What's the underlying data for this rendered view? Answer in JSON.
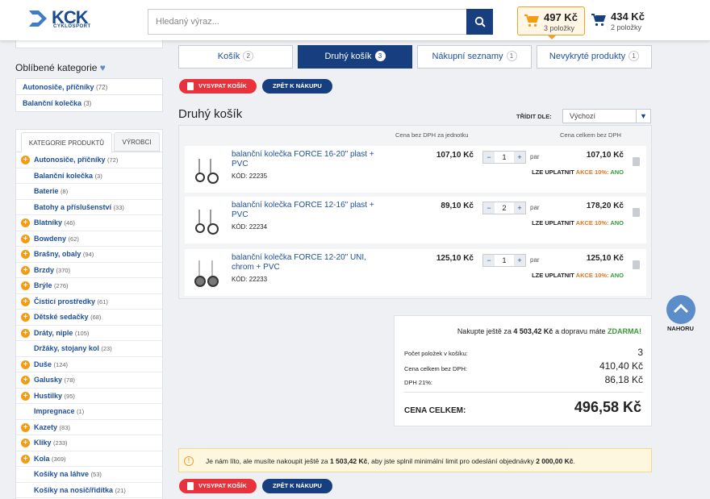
{
  "header": {
    "logo_text": "KCK",
    "logo_sub": "CYKLOSPORT",
    "search_placeholder": "Hledaný výraz...",
    "cart1": {
      "price": "497 Kč",
      "items": "3 položky"
    },
    "cart2": {
      "price": "434 Kč",
      "items": "2 položky"
    }
  },
  "sidebar": {
    "fav_title": "Oblíbené kategorie",
    "fav_items": [
      {
        "label": "Autonosiče, příčníky",
        "count": "(72)"
      },
      {
        "label": "Balanční kolečka",
        "count": "(3)"
      }
    ],
    "tab_categories": "KATEGORIE PRODUKTŮ",
    "tab_makers": "VÝROBCI",
    "categories": [
      {
        "label": "Autonosiče, příčníky",
        "count": "(72)",
        "plus": true
      },
      {
        "label": "Balanční kolečka",
        "count": "(3)",
        "plus": false
      },
      {
        "label": "Baterie",
        "count": "(8)",
        "plus": false
      },
      {
        "label": "Batohy a příslušenství",
        "count": "(33)",
        "plus": false
      },
      {
        "label": "Blatníky",
        "count": "(46)",
        "plus": true
      },
      {
        "label": "Bowdeny",
        "count": "(62)",
        "plus": true
      },
      {
        "label": "Brašny, obaly",
        "count": "(94)",
        "plus": true
      },
      {
        "label": "Brzdy",
        "count": "(370)",
        "plus": true
      },
      {
        "label": "Brýle",
        "count": "(276)",
        "plus": true
      },
      {
        "label": "Čisticí prostředky",
        "count": "(61)",
        "plus": true
      },
      {
        "label": "Dětské sedačky",
        "count": "(68)",
        "plus": true
      },
      {
        "label": "Dráty, niple",
        "count": "(105)",
        "plus": true
      },
      {
        "label": "Držáky, stojany kol",
        "count": "(23)",
        "plus": false
      },
      {
        "label": "Duše",
        "count": "(124)",
        "plus": true
      },
      {
        "label": "Galusky",
        "count": "(78)",
        "plus": true
      },
      {
        "label": "Hustilky",
        "count": "(95)",
        "plus": true
      },
      {
        "label": "Impregnace",
        "count": "(1)",
        "plus": false
      },
      {
        "label": "Kazety",
        "count": "(83)",
        "plus": true
      },
      {
        "label": "Kliky",
        "count": "(233)",
        "plus": true
      },
      {
        "label": "Kola",
        "count": "(369)",
        "plus": true
      },
      {
        "label": "Košíky na láhve",
        "count": "(53)",
        "plus": false
      },
      {
        "label": "Košíky na nosič/řidítka",
        "count": "(21)",
        "plus": false
      }
    ]
  },
  "tabs": [
    {
      "label": "Košík",
      "badge": "2"
    },
    {
      "label": "Druhý košík",
      "badge": "3"
    },
    {
      "label": "Nákupní seznamy",
      "badge": "1"
    },
    {
      "label": "Nevykryté produkty",
      "badge": "1"
    }
  ],
  "actions": {
    "empty_cart": "VYSYPAT KOŠÍK",
    "back": "ZPĚT K NÁKUPU"
  },
  "cart": {
    "title": "Druhý košík",
    "sort_label": "TŘÍDIT DLE:",
    "sort_value": "Výchozí",
    "col_unit": "Cena bez DPH za jednotku",
    "col_total": "Cena celkem bez DPH",
    "code_label": "KÓD:",
    "promo_label": "LZE UPLATNIT",
    "promo_action": "AKCE 10%:",
    "promo_yes": "ANO",
    "products": [
      {
        "name": "balanční kolečka FORCE 16-20\" plast + PVC",
        "code": "22235",
        "unit_price": "107,10 Kč",
        "qty": "1",
        "unit": "par",
        "total": "107,10 Kč"
      },
      {
        "name": "balanční kolečka FORCE 12-16\" plast + PVC",
        "code": "22234",
        "unit_price": "89,10 Kč",
        "qty": "2",
        "unit": "par",
        "total": "178,20 Kč"
      },
      {
        "name": "balanční kolečka FORCE 12-20\" UNI, chrom + PVC",
        "code": "22233",
        "unit_price": "125,10 Kč",
        "qty": "1",
        "unit": "par",
        "total": "125,10 Kč"
      }
    ]
  },
  "summary": {
    "free_pre": "Nakupte ještě za",
    "free_amount": "4 503,42 Kč",
    "free_mid": "a dopravu máte",
    "free_word": "ZDARMA!",
    "count_label": "Počet položek v košíku:",
    "count_value": "3",
    "net_label": "Cena celkem bez DPH:",
    "net_value": "410,40 Kč",
    "vat_label": "DPH 21%:",
    "vat_value": "86,18 Kč",
    "total_label": "CENA CELKEM:",
    "total_value": "496,58 Kč"
  },
  "notice": {
    "pre": "Je nám líto, ale musíte nakoupit ještě za",
    "amount": "1 503,42 Kč",
    "mid": ", aby jste splnil minimální limit pro odeslání objednávky",
    "limit": "2 000,00 Kč",
    "post": "."
  },
  "scroll_top": "NAHORU",
  "colors": {
    "brand": "#173f80",
    "accent": "#f39c12",
    "danger": "#e8333c",
    "promo": "#e8731c",
    "ok": "#3a9a3a"
  }
}
